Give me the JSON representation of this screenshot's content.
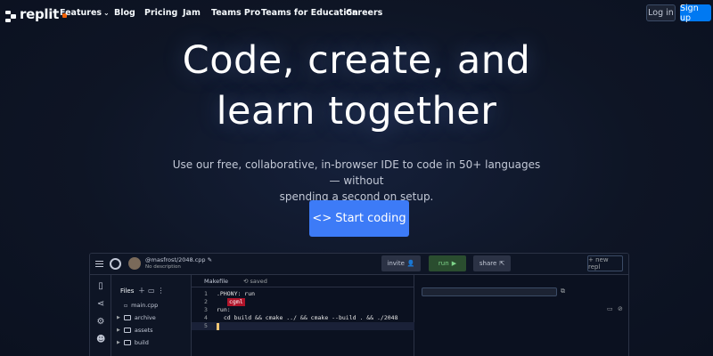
{
  "nav": {
    "logo_text": "replit",
    "items": [
      {
        "label": "Features",
        "has_dropdown": true
      },
      {
        "label": "Blog"
      },
      {
        "label": "Pricing"
      },
      {
        "label": "Jam"
      },
      {
        "label": "Teams Pro"
      },
      {
        "label": "Teams for Education"
      },
      {
        "label": "Careers"
      }
    ],
    "login_label": "Log in",
    "signup_label": "Sign up"
  },
  "hero": {
    "title_line1": "Code, create, and",
    "title_line2": "learn together",
    "subtitle_line1": "Use our free, collaborative, in-browser IDE to code in 50+ languages — without",
    "subtitle_line2": "spending a second on setup.",
    "cta_icon": "<>",
    "cta_label": "Start coding"
  },
  "ide": {
    "repl_name": "@masfrost/2048.cpp",
    "repl_description": "No description",
    "invite_label": "invite",
    "run_label": "run",
    "share_label": "share",
    "new_repl_label": "+ new repl",
    "files_label": "Files",
    "files": [
      {
        "name": "main.cpp",
        "type": "file"
      },
      {
        "name": "archive",
        "type": "folder"
      },
      {
        "name": "assets",
        "type": "folder"
      },
      {
        "name": "build",
        "type": "folder"
      }
    ],
    "editor_tab": "Makefile",
    "saved_label": "saved",
    "code_lines": [
      {
        "num": "1",
        "text": ".PHONY: run"
      },
      {
        "num": "2",
        "text": ""
      },
      {
        "num": "3",
        "text": "run:"
      },
      {
        "num": "4",
        "text": "  cd build && cmake ../ && cmake --build . && ./2048"
      },
      {
        "num": "5",
        "text": ""
      }
    ],
    "collaborator_tag": "cgml"
  },
  "colors": {
    "background": "#0e1525",
    "primary_button": "#0079f2",
    "cta_button": "#3d7bf7",
    "run_button": "#2a4d2f",
    "collaborator_tag": "#b0142a"
  }
}
